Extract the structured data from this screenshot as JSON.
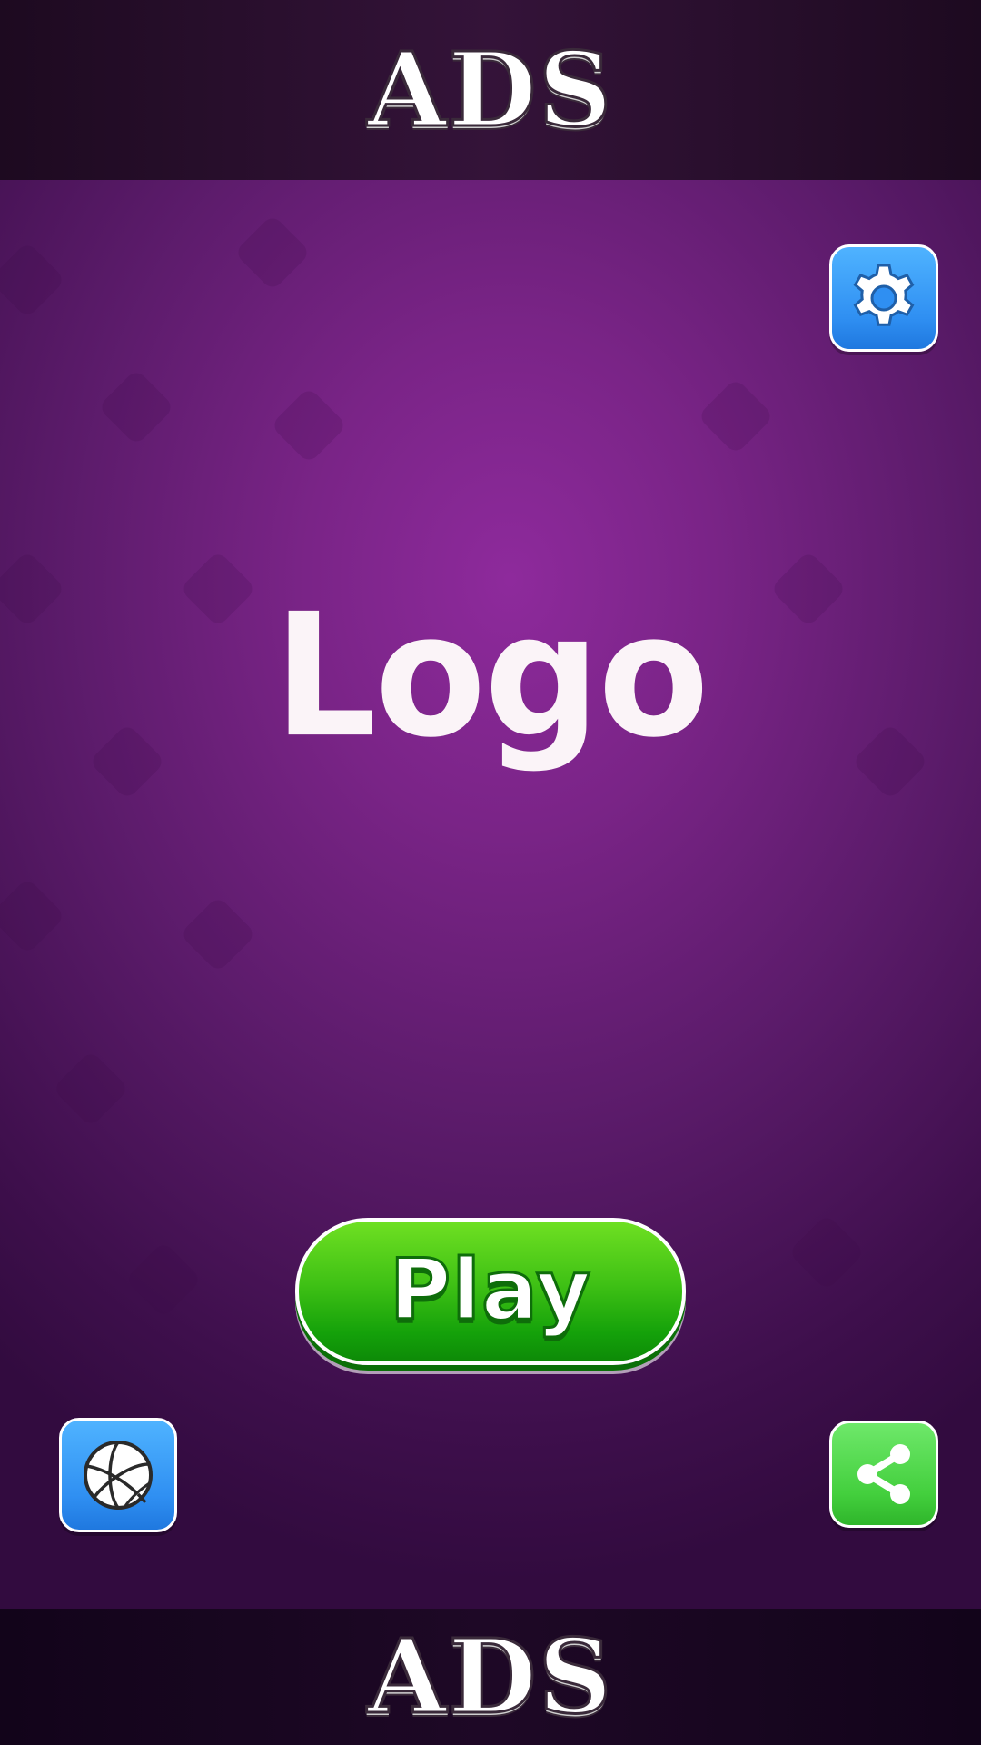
{
  "ads_top": {
    "label": "ADS"
  },
  "ads_bottom": {
    "label": "ADS"
  },
  "logo": {
    "text": "Logo"
  },
  "play_button": {
    "label": "Play"
  },
  "buttons": {
    "settings": {
      "icon": "gear-icon"
    },
    "ball": {
      "icon": "basketball-icon"
    },
    "share": {
      "icon": "share-icon"
    }
  },
  "colors": {
    "background": "#8e2a9c",
    "ads_bar": "#341339",
    "blue_button": "#2f8ff2",
    "green_button": "#43cf3d",
    "play_button": "#3fc115"
  }
}
